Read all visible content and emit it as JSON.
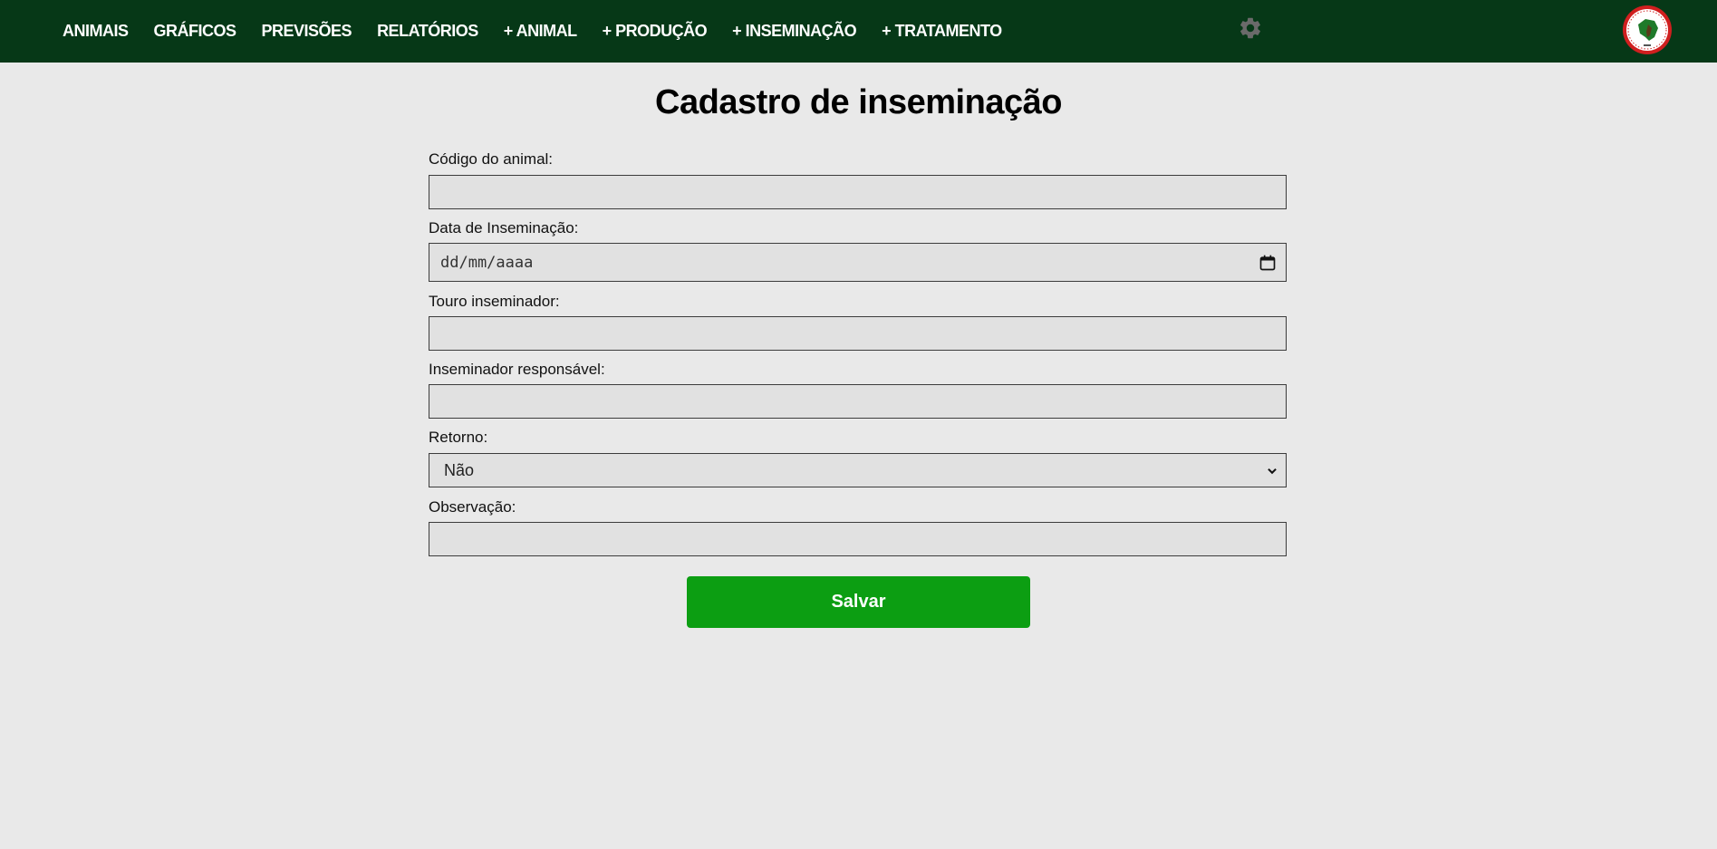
{
  "nav": {
    "items": [
      {
        "label": "ANIMAIS"
      },
      {
        "label": "GRÁFICOS"
      },
      {
        "label": "PREVISÕES"
      },
      {
        "label": "RELATÓRIOS"
      },
      {
        "label": "+ ANIMAL"
      },
      {
        "label": "+ PRODUÇÃO"
      },
      {
        "label": "+ INSEMINAÇÃO"
      },
      {
        "label": "+ TRATAMENTO"
      }
    ],
    "settings_icon": "gear-icon",
    "logo_icon": "circular-brand-logo",
    "colors": {
      "bar": "#063817",
      "text": "#ffffff"
    }
  },
  "page": {
    "title": "Cadastro de inseminação"
  },
  "form": {
    "codigo": {
      "label": "Código do animal:",
      "value": ""
    },
    "data": {
      "label": "Data de Inseminação:",
      "placeholder": "dd/mm/aaaa",
      "icon": "calendar-icon"
    },
    "touro": {
      "label": "Touro inseminador:",
      "value": ""
    },
    "inseminador": {
      "label": "Inseminador responsável:",
      "value": ""
    },
    "retorno": {
      "label": "Retorno:",
      "selected": "Não",
      "icon": "chevron-down-icon"
    },
    "observacao": {
      "label": "Observação:",
      "value": ""
    },
    "save_label": "Salvar",
    "colors": {
      "save_button": "#0c9e12",
      "background": "#e9e9e9"
    }
  }
}
